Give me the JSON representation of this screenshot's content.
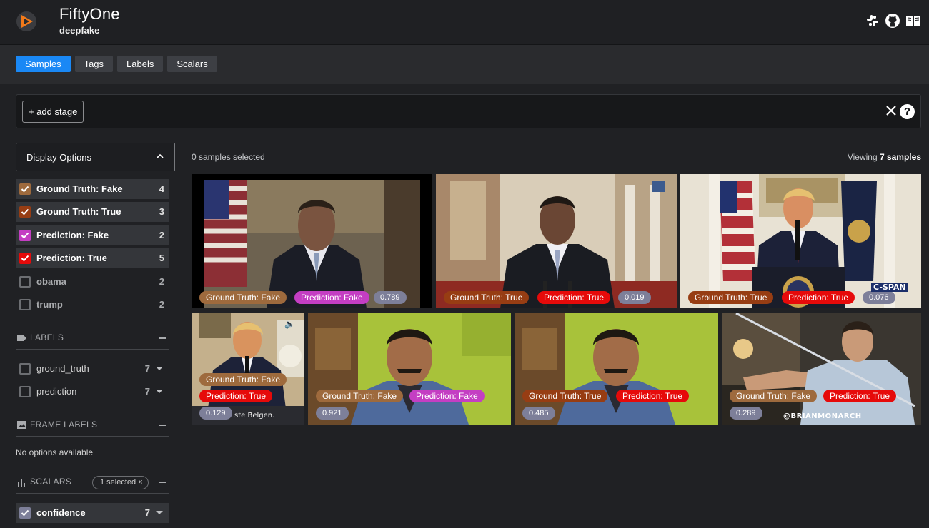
{
  "header": {
    "app_title": "FiftyOne",
    "dataset": "deepfake",
    "icons": [
      "slack-icon",
      "github-icon",
      "docs-book-icon"
    ]
  },
  "tabs": [
    {
      "label": "Samples",
      "active": true
    },
    {
      "label": "Tags",
      "active": false
    },
    {
      "label": "Labels",
      "active": false
    },
    {
      "label": "Scalars",
      "active": false
    }
  ],
  "stage_bar": {
    "add_stage_label": "+ add stage"
  },
  "sidebar": {
    "display_options_label": "Display Options",
    "tags": [
      {
        "label": "Ground Truth: Fake",
        "count": "4",
        "checked": true,
        "color": "#9e6a3d"
      },
      {
        "label": "Ground Truth: True",
        "count": "3",
        "checked": true,
        "color": "#973d13"
      },
      {
        "label": "Prediction: Fake",
        "count": "2",
        "checked": true,
        "color": "#c43ec3"
      },
      {
        "label": "Prediction: True",
        "count": "5",
        "checked": true,
        "color": "#e60a0a"
      },
      {
        "label": "obama",
        "count": "2",
        "checked": false
      },
      {
        "label": "trump",
        "count": "2",
        "checked": false
      }
    ],
    "labels_section": {
      "title": "LABELS",
      "items": [
        {
          "label": "ground_truth",
          "count": "7"
        },
        {
          "label": "prediction",
          "count": "7"
        }
      ]
    },
    "frame_labels_section": {
      "title": "FRAME LABELS",
      "empty_text": "No options available"
    },
    "scalars_section": {
      "title": "SCALARS",
      "selected_pill": "1 selected",
      "items": [
        {
          "label": "confidence",
          "count": "7",
          "checked": true,
          "color": "#7d7f99"
        }
      ]
    }
  },
  "grid": {
    "selected_text": "0 samples selected",
    "viewing_prefix": "Viewing ",
    "viewing_count": "7 samples",
    "samples": [
      {
        "ground_truth": "Ground Truth: Fake",
        "prediction": "Prediction: Fake",
        "confidence": "0.789"
      },
      {
        "ground_truth": "Ground Truth: True",
        "prediction": "Prediction: True",
        "confidence": "0.019"
      },
      {
        "ground_truth": "Ground Truth: True",
        "prediction": "Prediction: True",
        "confidence": "0.076",
        "watermark": "C-SPAN"
      },
      {
        "ground_truth": "Ground Truth: Fake",
        "prediction": "Prediction: True",
        "confidence": "0.129",
        "caption": "ste Belgen."
      },
      {
        "ground_truth": "Ground Truth: Fake",
        "prediction": "Prediction: Fake",
        "confidence": "0.921"
      },
      {
        "ground_truth": "Ground Truth: True",
        "prediction": "Prediction: True",
        "confidence": "0.485"
      },
      {
        "ground_truth": "Ground Truth: Fake",
        "prediction": "Prediction: True",
        "confidence": "0.289",
        "watermark": "@BRIANMONARCH"
      }
    ]
  }
}
